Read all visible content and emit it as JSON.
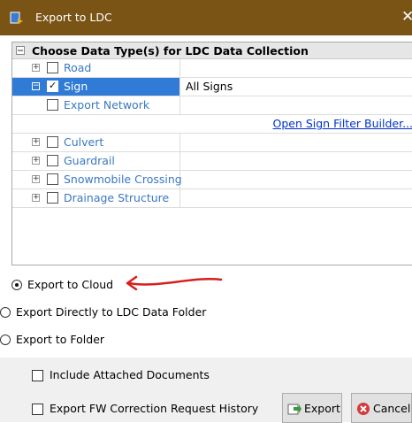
{
  "window": {
    "title": "Export to LDC",
    "close_glyph": "✕"
  },
  "grid": {
    "header": "Choose Data Type(s) for LDC Data Collection",
    "rows": [
      {
        "label": "Road",
        "value": "",
        "checked": false
      },
      {
        "label": "Sign",
        "value": "All Signs",
        "checked": true
      },
      {
        "label": "Export Network",
        "value": "",
        "checked": false
      },
      {
        "label": "Culvert",
        "value": "",
        "checked": false
      },
      {
        "label": "Guardrail",
        "value": "",
        "checked": false
      },
      {
        "label": "Snowmobile Crossing",
        "value": "",
        "checked": false
      },
      {
        "label": "Drainage Structure",
        "value": "",
        "checked": false
      }
    ],
    "filter_link": "Open Sign Filter Builder..."
  },
  "export_options": {
    "cloud": "Export to Cloud",
    "ldc_folder": "Export Directly to LDC Data Folder",
    "folder": "Export to Folder",
    "selected": "cloud"
  },
  "options": {
    "attached_docs": "Include Attached Documents",
    "correction_history": "Export FW Correction Request History"
  },
  "buttons": {
    "export": "Export",
    "cancel": "Cancel"
  },
  "colors": {
    "titlebar": "#7a5415",
    "selection": "#2f7bd6",
    "link": "#0033cc",
    "annotation_arrow": "#d42020"
  }
}
